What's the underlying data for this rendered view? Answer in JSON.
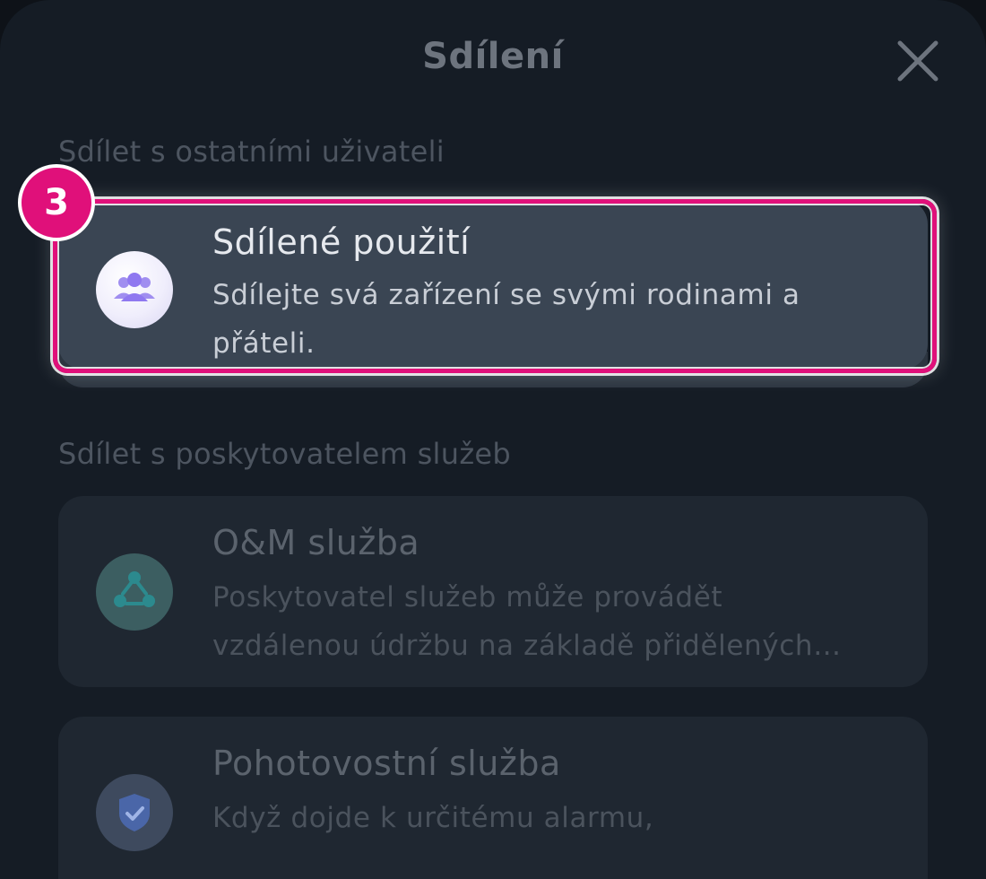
{
  "header": {
    "title": "Sdílení",
    "close_icon": "close-icon"
  },
  "sections": [
    {
      "title": "Sdílet s ostatními uživateli",
      "items": [
        {
          "title": "Sdílené použití",
          "description": "Sdílejte svá zařízení se svými rodinami a přáteli.",
          "icon": "group-users-icon",
          "highlighted": true
        }
      ]
    },
    {
      "title": "Sdílet s poskytovatelem služeb",
      "items": [
        {
          "title": "O&M služba",
          "description": "Poskytovatel služeb může provádět vzdálenou údržbu na základě přidělených oprávnění.",
          "icon": "share-network-icon"
        },
        {
          "title": "Pohotovostní služba",
          "description": "Když dojde k určitému alarmu,",
          "icon": "shield-check-icon"
        }
      ]
    }
  ],
  "annotation": {
    "step_number": "3"
  },
  "colors": {
    "accent": "#e0107a",
    "background": "#151c25",
    "highlight_card": "#3a4553"
  }
}
